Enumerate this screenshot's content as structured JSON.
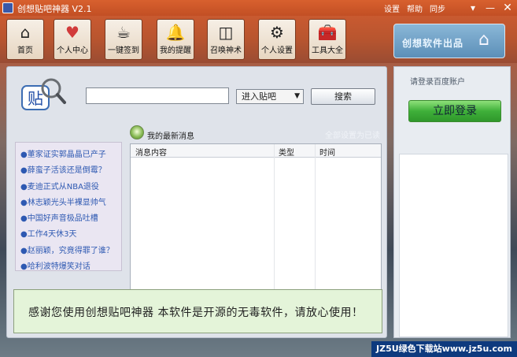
{
  "window": {
    "title": "创想贴吧神器 V2.1",
    "top_menu": [
      "设置",
      "帮助",
      "同步"
    ],
    "controls": [
      "▾",
      "—",
      "✕"
    ]
  },
  "toolbar": [
    {
      "label": "首页",
      "icon": "home-icon",
      "glyph": "⌂"
    },
    {
      "label": "个人中心",
      "icon": "heart-icon",
      "glyph": "♥"
    },
    {
      "label": "一键签到",
      "icon": "stamp-icon",
      "glyph": "☕"
    },
    {
      "label": "我的提醒",
      "icon": "bell-icon",
      "glyph": "🔔"
    },
    {
      "label": "召唤神术",
      "icon": "binoculars-icon",
      "glyph": "◫"
    },
    {
      "label": "个人设置",
      "icon": "gear-icon",
      "glyph": "⚙"
    },
    {
      "label": "工具大全",
      "icon": "toolbox-icon",
      "glyph": "🧰"
    }
  ],
  "brand": {
    "text": "创想软件出品"
  },
  "search": {
    "placeholder": "",
    "select_value": "进入贴吧",
    "button_label": "搜索"
  },
  "news": [
    "●董家证实郭晶晶已产子",
    "●薛蛮子活该还是倒霉？",
    "●麦迪正式从NBA退役",
    "●林志颖光头半裸显帅气",
    "●中国好声音极品吐槽",
    "●工作4天休3天",
    "●赵丽颖，究竟得罪了谁？",
    "●哈利波特爆笑对话"
  ],
  "messages": {
    "title": "我的最新消息",
    "mark_all_read": "全部设置为已读",
    "columns": [
      "消息内容",
      "类型",
      "时间"
    ],
    "rows": []
  },
  "notice": {
    "text": "感谢您使用创想贴吧神器  本软件是开源的无毒软件，请放心使用！"
  },
  "login": {
    "hint": "请登录百度账户",
    "button_label": "立即登录"
  },
  "watermark": {
    "text": "JZ5U绿色下载站www.jz5u.com"
  }
}
